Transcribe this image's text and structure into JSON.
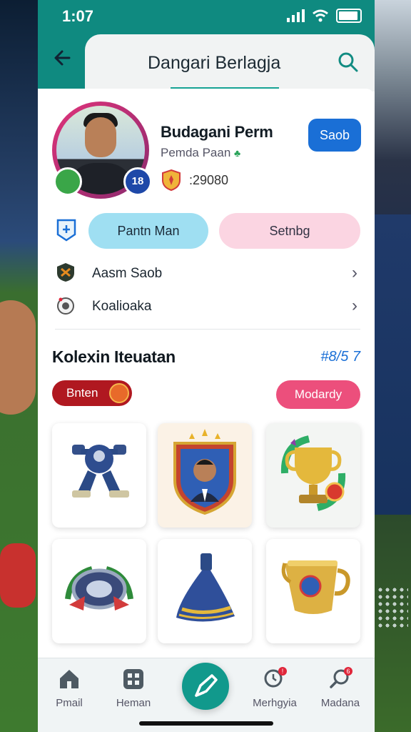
{
  "status_bar": {
    "time": "1:07"
  },
  "header": {
    "title": "Dangari Berlagja"
  },
  "profile": {
    "name": "Budagani Perm",
    "subtitle": "Pemda Paan",
    "points": ":29080",
    "badge_number": "18",
    "save_label": "Saob"
  },
  "tabs": {
    "primary": "Pantn Man",
    "secondary": "Setnbg"
  },
  "list": [
    {
      "label": "Aasm Saob"
    },
    {
      "label": "Koalioaka"
    }
  ],
  "collection": {
    "title": "Kolexin Iteuatan",
    "count": "#8/5 7",
    "filter_left": "Bnten",
    "filter_right": "Modardy"
  },
  "items": [
    {
      "name": "blue-mech-trophy"
    },
    {
      "name": "player-shield-badge"
    },
    {
      "name": "gold-cup-trophy"
    },
    {
      "name": "laurel-medal-emblem"
    },
    {
      "name": "blue-scarf-pennant"
    },
    {
      "name": "gold-beer-mug-trophy"
    }
  ],
  "nav": [
    {
      "label": "Pmail",
      "icon": "home-icon"
    },
    {
      "label": "Heman",
      "icon": "grid-icon"
    },
    {
      "label": "",
      "icon": "pen-icon"
    },
    {
      "label": "Merhgyia",
      "icon": "search-clock-icon"
    },
    {
      "label": "Madana",
      "icon": "magnify-icon"
    }
  ],
  "colors": {
    "accent": "#0f8a80",
    "primary_button": "#1a6fd6",
    "pink": "#ec4f7c"
  }
}
